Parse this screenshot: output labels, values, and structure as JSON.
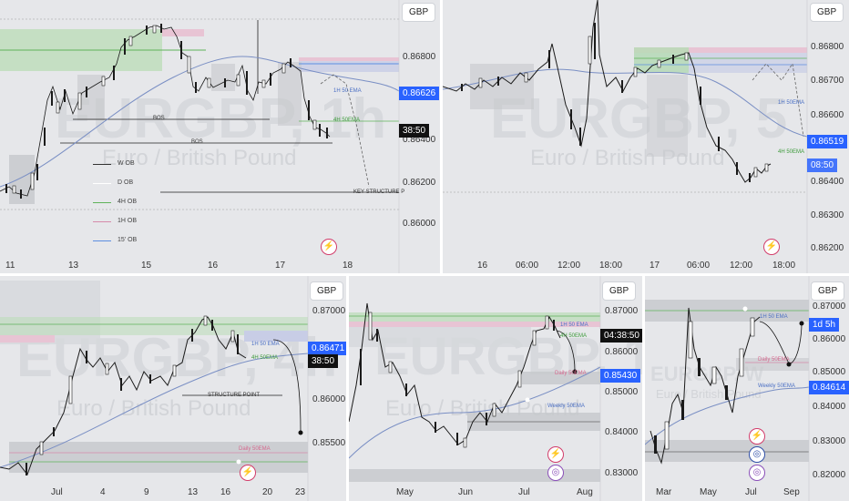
{
  "pane1": {
    "currency": "GBP",
    "watermark_symbol": "EURGBP, 1h",
    "watermark_desc": "Euro / British Pound",
    "y_ticks": [
      "0.86800",
      "0.86600",
      "0.86400",
      "0.86200",
      "0.86000"
    ],
    "x_ticks": [
      "11",
      "13",
      "15",
      "16",
      "17",
      "18"
    ],
    "price_badge": "0.86626",
    "timer_badge": "38:50",
    "labels": {
      "bos1": "BOS",
      "bos2": "BOS",
      "ema_1h": "1H 50 EMA",
      "ema_4h": "4H 50EMA",
      "key": "KEY STRUCTURE P"
    },
    "legend": [
      "W OB",
      "D OB",
      "4H OB",
      "1H OB",
      "15' OB"
    ]
  },
  "pane2": {
    "currency": "GBP",
    "watermark_symbol": "EURGBP, 5",
    "watermark_desc": "Euro / British Pound",
    "y_ticks": [
      "0.86800",
      "0.86700",
      "0.86600",
      "0.86500",
      "0.86400",
      "0.86300",
      "0.86200"
    ],
    "x_ticks": [
      "16",
      "06:00",
      "12:00",
      "18:00",
      "17",
      "06:00",
      "12:00",
      "18:00"
    ],
    "price_badge": "0.86519",
    "timer_badge": "08:50",
    "labels": {
      "ema_1h": "1H 50EMA",
      "ema_4h": "4H 50EMA"
    }
  },
  "pane3": {
    "currency": "GBP",
    "watermark_symbol": "EURGBP, 4h",
    "watermark_desc": "Euro / British Pound",
    "y_ticks": [
      "0.87000",
      "0.86500",
      "0.86000",
      "0.85500"
    ],
    "x_ticks": [
      "Jul",
      "4",
      "9",
      "13",
      "16",
      "20",
      "23"
    ],
    "price_badge": "0.86471",
    "timer_badge": "38:50",
    "labels": {
      "ema_1h": "1H 50 EMA",
      "ema_4h": "4H 50EMA",
      "structure": "STRUCTURE POINT",
      "daily": "Daily 50EMA"
    }
  },
  "pane4": {
    "currency": "GBP",
    "watermark_symbol": "EURGBP, 1D",
    "watermark_desc": "Euro / British Pound",
    "y_ticks": [
      "0.87000",
      "0.86000",
      "0.85000",
      "0.84000",
      "0.83000"
    ],
    "x_ticks": [
      "May",
      "Jun",
      "Jul",
      "Aug"
    ],
    "price_badge": "0.85430",
    "timer_badge": "04:38:50",
    "labels": {
      "ema_1h": "1H 50 EMA",
      "ema_4h": "4H 50EMA",
      "daily": "Daily 50EMA",
      "weekly": "Weekly 50EMA"
    }
  },
  "pane5": {
    "currency": "GBP",
    "watermark_symbol": "EURGBP, W",
    "watermark_desc": "Euro / British Pound",
    "y_ticks": [
      "0.87000",
      "0.86000",
      "0.85000",
      "0.84000",
      "0.83000",
      "0.82000"
    ],
    "x_ticks": [
      "Mar",
      "May",
      "Jul",
      "Sep"
    ],
    "price_badge": "0.84614",
    "timer_badge": "1d 5h",
    "labels": {
      "ema_1h": "1H 50 EMA",
      "daily": "Daily 50EMA",
      "weekly": "Weekly 50EMA"
    }
  },
  "colors": {
    "up": "#ffffff",
    "down": "#1a1a1a",
    "price_badge": "#2962ff",
    "timer": "#111111",
    "green_zone": "#b9dcb6",
    "pink_zone": "#e8c4d4",
    "gray_zone": "#c6c8cc",
    "ema": "#7a8fc4"
  }
}
